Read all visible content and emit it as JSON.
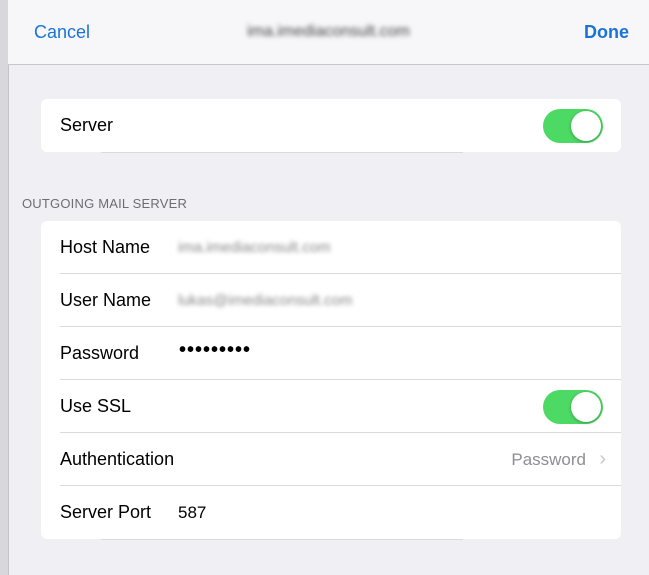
{
  "navbar": {
    "cancel_label": "Cancel",
    "title": "ima.imediaconsult.com",
    "done_label": "Done"
  },
  "server_group": {
    "label": "Server",
    "toggle_on": true
  },
  "section_header": "OUTGOING MAIL SERVER",
  "outgoing": {
    "host_name_label": "Host Name",
    "host_name_value": "ima.imediaconsult.com",
    "user_name_label": "User Name",
    "user_name_value": "lukas@imediaconsult.com",
    "password_label": "Password",
    "password_value": "•••••••••",
    "use_ssl_label": "Use SSL",
    "use_ssl_on": true,
    "authentication_label": "Authentication",
    "authentication_value": "Password",
    "server_port_label": "Server Port",
    "server_port_value": "587"
  },
  "colors": {
    "accent": "#1a73d9",
    "toggle_on": "#4cd964",
    "background": "#efeff4"
  }
}
